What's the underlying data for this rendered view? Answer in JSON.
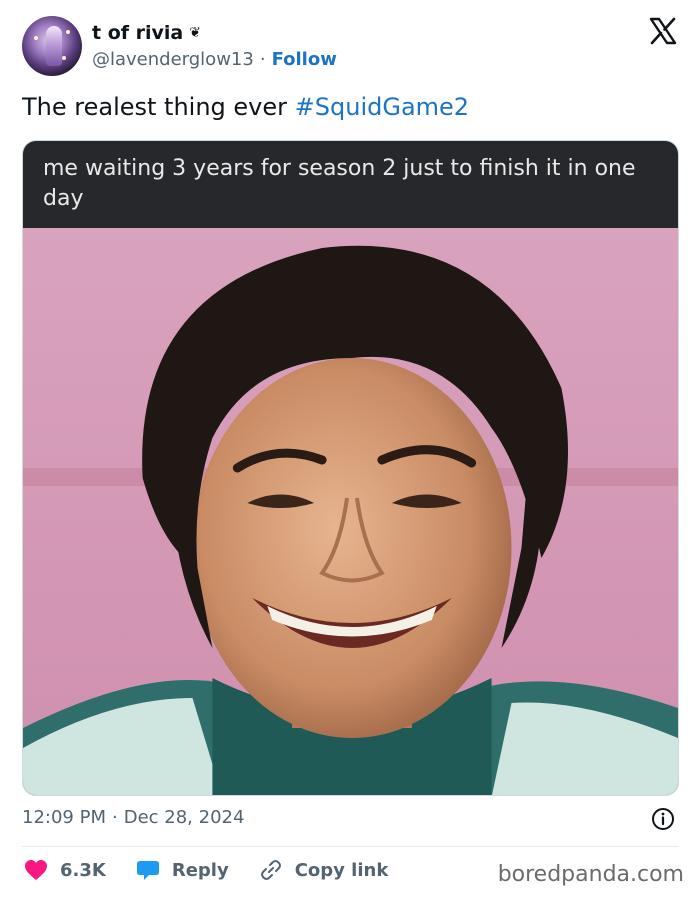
{
  "author": {
    "display_name": "t of rivia",
    "name_emoji": "❦",
    "handle": "@lavenderglow13",
    "separator": "·",
    "follow_label": "Follow"
  },
  "platform_icon": "x-logo-icon",
  "tweet": {
    "text": "The realest thing ever ",
    "hashtag": "#SquidGame2"
  },
  "media": {
    "caption": "me waiting 3 years for season 2 just to finish it in one day"
  },
  "meta": {
    "time": "12:09 PM",
    "separator": "·",
    "date": "Dec 28, 2024"
  },
  "actions": {
    "like_count": "6.3K",
    "reply_label": "Reply",
    "copy_link_label": "Copy link"
  },
  "watermark": "boredpanda.com",
  "colors": {
    "link_blue": "#1d74c4",
    "like_red": "#f91880",
    "reply_blue": "#1d9bf0",
    "caption_bg": "#26282b",
    "photo_wall": "#d79ab5"
  }
}
